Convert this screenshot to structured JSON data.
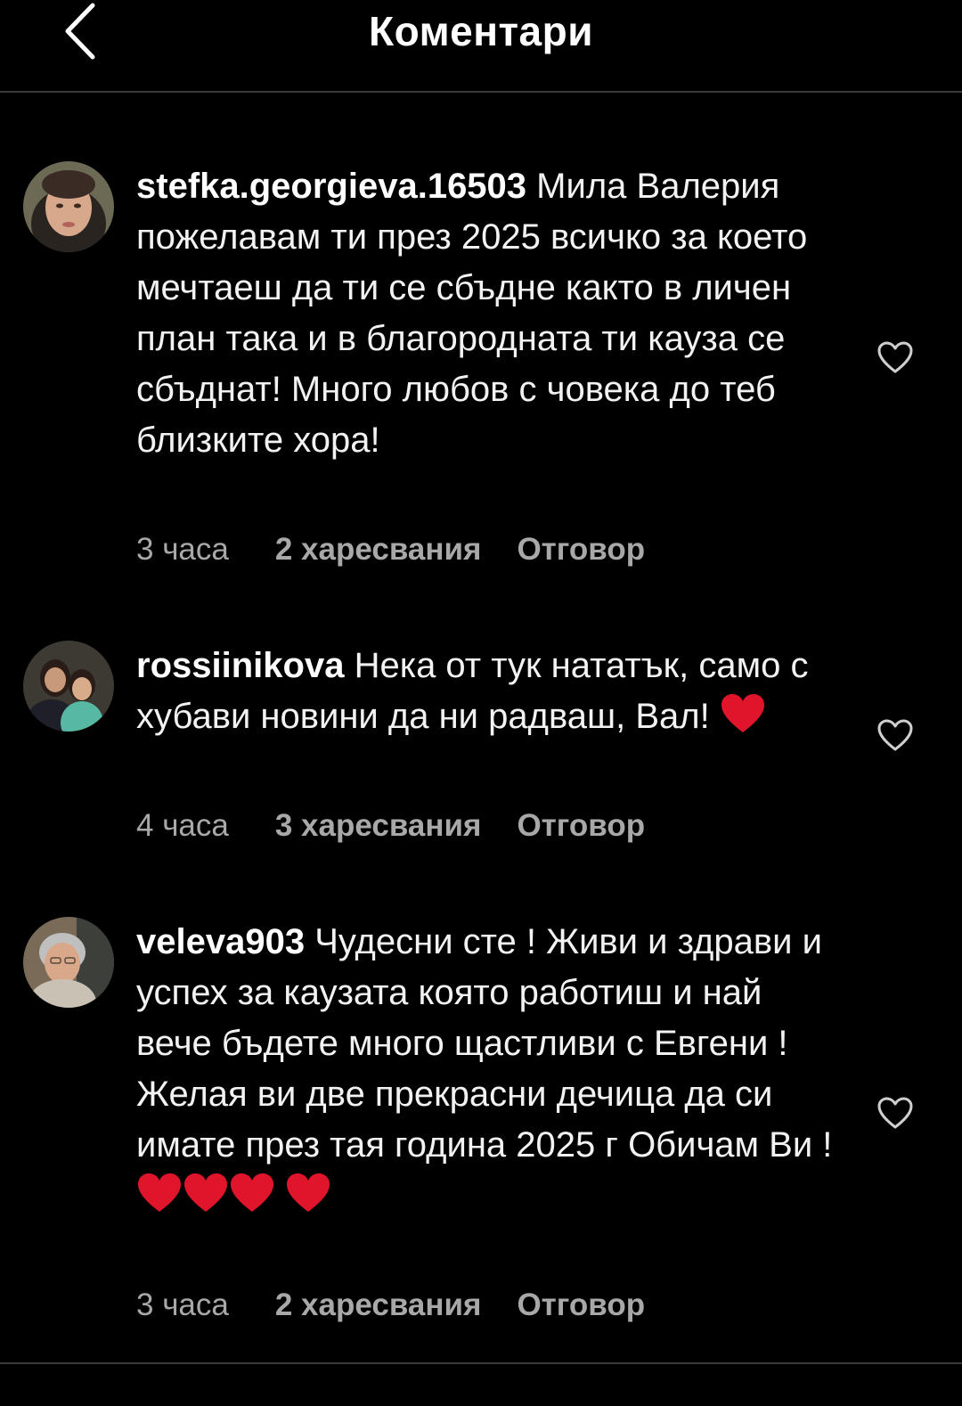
{
  "header": {
    "title": "Коментари",
    "back_icon": "chevron-left-icon"
  },
  "colors": {
    "background": "#000000",
    "text": "#f2f2f2",
    "meta": "#a8a8a8",
    "heart": "#e0142a"
  },
  "comments": [
    {
      "username": "stefka.georgieva.16503",
      "text": "Мила Валерия пожелавам ти през 2025 всичко за което мечтаеш да ти се сбъдне както в личен план така и в благородната ти кауза се сбъднат! Много любов с човека до теб близките хора!",
      "time": "3 часа",
      "likes": "2 харесвания",
      "reply": "Отговор",
      "emoji": ""
    },
    {
      "username": "rossiinikova",
      "text": "Нека от тук нататък, само с хубави новини да ни радваш, Вал!",
      "time": "4 часа",
      "likes": "3 харесвания",
      "reply": "Отговор",
      "emoji": "❤️"
    },
    {
      "username": "veleva903",
      "text": "Чудесни сте ! Живи и здрави и успех за каузата която работиш и най вече бъдете много щастливи с Евгени ! Желая ви две прекрасни дечица да си имате през тая година 2025 г Обичам Ви !",
      "time": "3 часа",
      "likes": "2 харесвания",
      "reply": "Отговор",
      "emoji": "❤️❤️❤️❤️"
    }
  ]
}
